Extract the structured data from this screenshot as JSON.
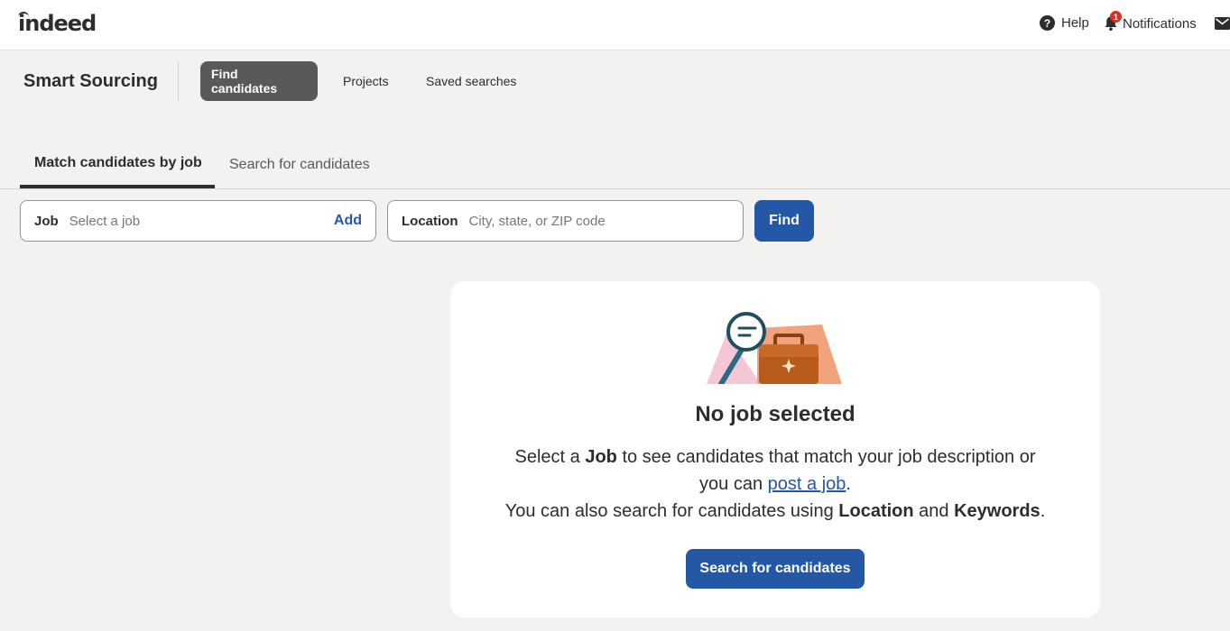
{
  "header": {
    "logo": "indeed",
    "help_label": "Help",
    "notifications_label": "Notifications",
    "notifications_count": "1"
  },
  "subnav": {
    "brand": "Smart Sourcing",
    "items": [
      {
        "label": "Find candidates",
        "active": true
      },
      {
        "label": "Projects",
        "active": false
      },
      {
        "label": "Saved searches",
        "active": false
      }
    ]
  },
  "tabs": [
    {
      "label": "Match candidates by job",
      "active": true
    },
    {
      "label": "Search for candidates",
      "active": false
    }
  ],
  "search": {
    "job_label": "Job",
    "job_placeholder": "Select a job",
    "job_add": "Add",
    "location_label": "Location",
    "location_placeholder": "City, state, or ZIP code",
    "find_label": "Find"
  },
  "empty_state": {
    "title": "No job selected",
    "line1_pre": "Select a ",
    "line1_bold": "Job",
    "line1_post": " to see candidates that match your job description or",
    "line2_pre": "you can ",
    "line2_link": "post a job",
    "line2_post": ".",
    "line3_pre": "You can also search for candidates using ",
    "line3_bold1": "Location",
    "line3_mid": " and ",
    "line3_bold2": "Keywords",
    "line3_post": ".",
    "button_label": "Search for candidates"
  },
  "colors": {
    "accent": "#2557a7",
    "active_nav": "#595959",
    "background": "#f3f2f1"
  }
}
